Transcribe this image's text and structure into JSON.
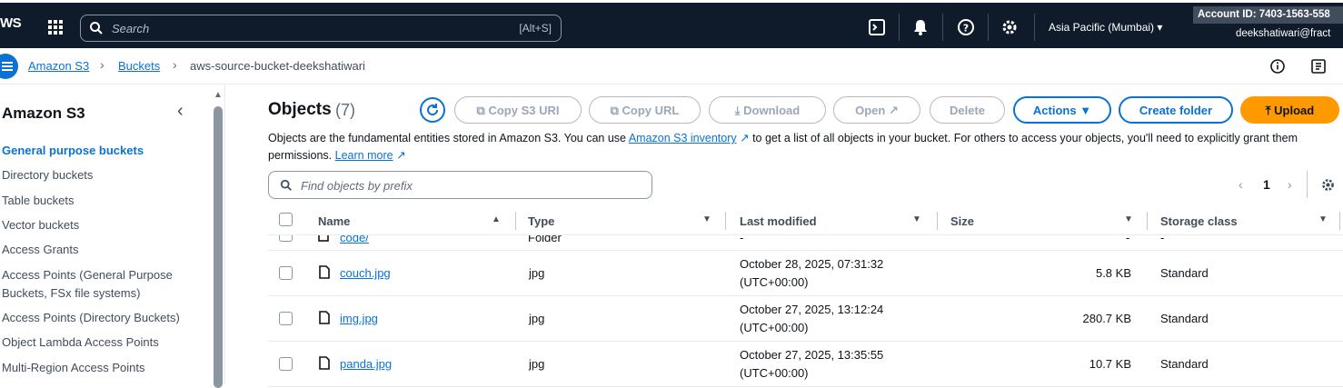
{
  "topnav": {
    "logo": "WS",
    "search_placeholder": "Search",
    "search_shortcut": "[Alt+S]",
    "icons": [
      "cloudshell-icon",
      "bell-icon",
      "help-icon",
      "settings-icon"
    ],
    "region": "Asia Pacific (Mumbai) ▾",
    "account_id": "Account ID: 7403-1563-558",
    "user": "deekshatiwari@fract"
  },
  "breadcrumb": {
    "items": [
      "Amazon S3",
      "Buckets"
    ],
    "current": "aws-source-bucket-deekshatiwari"
  },
  "sidebar": {
    "title": "Amazon S3",
    "items": [
      {
        "label": "General purpose buckets",
        "active": true
      },
      {
        "label": "Directory buckets"
      },
      {
        "label": "Table buckets"
      },
      {
        "label": "Vector buckets"
      },
      {
        "label": "Access Grants"
      },
      {
        "label": "Access Points (General Purpose Buckets, FSx file systems)"
      },
      {
        "label": "Access Points (Directory Buckets)"
      },
      {
        "label": "Object Lambda Access Points"
      },
      {
        "label": "Multi-Region Access Points"
      }
    ]
  },
  "objects": {
    "title": "Objects",
    "count": "(7)",
    "buttons": {
      "copy_s3_uri": "Copy S3 URI",
      "copy_url": "Copy URL",
      "download": "Download",
      "open": "Open",
      "delete": "Delete",
      "actions": "Actions ▼",
      "create_folder": "Create folder",
      "upload": "Upload"
    },
    "description_1": "Objects are the fundamental entities stored in Amazon S3. You can use",
    "inventory_link": "Amazon S3 inventory",
    "description_2": "to get a list of all objects in your bucket. For others to access your objects, you'll need to explicitly grant them permissions.",
    "learn_more": "Learn more",
    "filter_placeholder": "Find objects by prefix",
    "page": "1"
  },
  "table": {
    "columns": [
      "Name",
      "Type",
      "Last modified",
      "Size",
      "Storage class"
    ],
    "partial_row": {
      "name": "code/",
      "type": "Folder",
      "last_modified": "-",
      "size": "-",
      "storage_class": "-"
    },
    "rows": [
      {
        "name": "couch.jpg",
        "type": "jpg",
        "last_modified": "October 28, 2025, 07:31:32",
        "tz": "(UTC+00:00)",
        "size": "5.8 KB",
        "storage_class": "Standard"
      },
      {
        "name": "img.jpg",
        "type": "jpg",
        "last_modified": "October 27, 2025, 13:12:24",
        "tz": "(UTC+00:00)",
        "size": "280.7 KB",
        "storage_class": "Standard"
      },
      {
        "name": "panda.jpg",
        "type": "jpg",
        "last_modified": "October 27, 2025, 13:35:55",
        "tz": "(UTC+00:00)",
        "size": "10.7 KB",
        "storage_class": "Standard"
      }
    ]
  },
  "colors": {
    "accent": "#0972d3",
    "nav_bg": "#0f1b2a",
    "upload": "#ff9900"
  }
}
